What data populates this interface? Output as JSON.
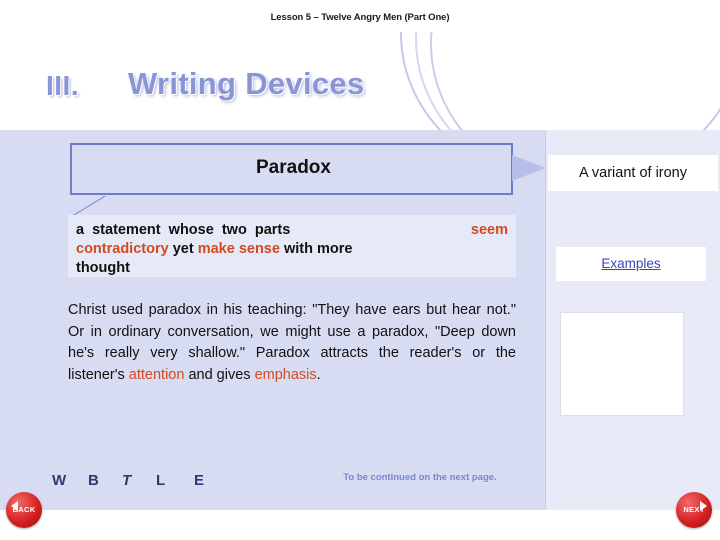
{
  "header": {
    "lesson_label": "Lesson 5 – Twelve Angry Men (Part One)"
  },
  "title": {
    "number": "III.",
    "main": "Writing Devices"
  },
  "callout": {
    "term": "Paradox"
  },
  "definition": {
    "line1_a": "a  statement  whose  two  parts",
    "line1_b": "seem",
    "line2_a": "contradictory",
    "line2_b": "yet",
    "line2_c": "make  sense",
    "line2_d": "with  more",
    "line3": "thought"
  },
  "body": {
    "text_1": "Christ used paradox in his teaching: \"They have ears but hear not.\" Or in ordinary conversation, we might use a paradox, \"Deep down he's really very shallow.\" Paradox attracts the reader's or the listener's ",
    "highlight_1": "attention",
    "text_2": " and gives ",
    "highlight_2": "emphasis",
    "text_3": "."
  },
  "right": {
    "note": "A variant of irony",
    "examples_link": "Examples"
  },
  "letters": [
    "W",
    "B",
    "T",
    "L",
    "E"
  ],
  "footer": {
    "continued": "To be continued on the next page.",
    "back_label": "BACK",
    "next_label": "NEXT"
  },
  "colors": {
    "title": "#8a95d6",
    "panel": "#d8dcf2",
    "accent_red": "#d34a22",
    "link": "#3a46b4",
    "box_border": "#6f7ccc"
  }
}
